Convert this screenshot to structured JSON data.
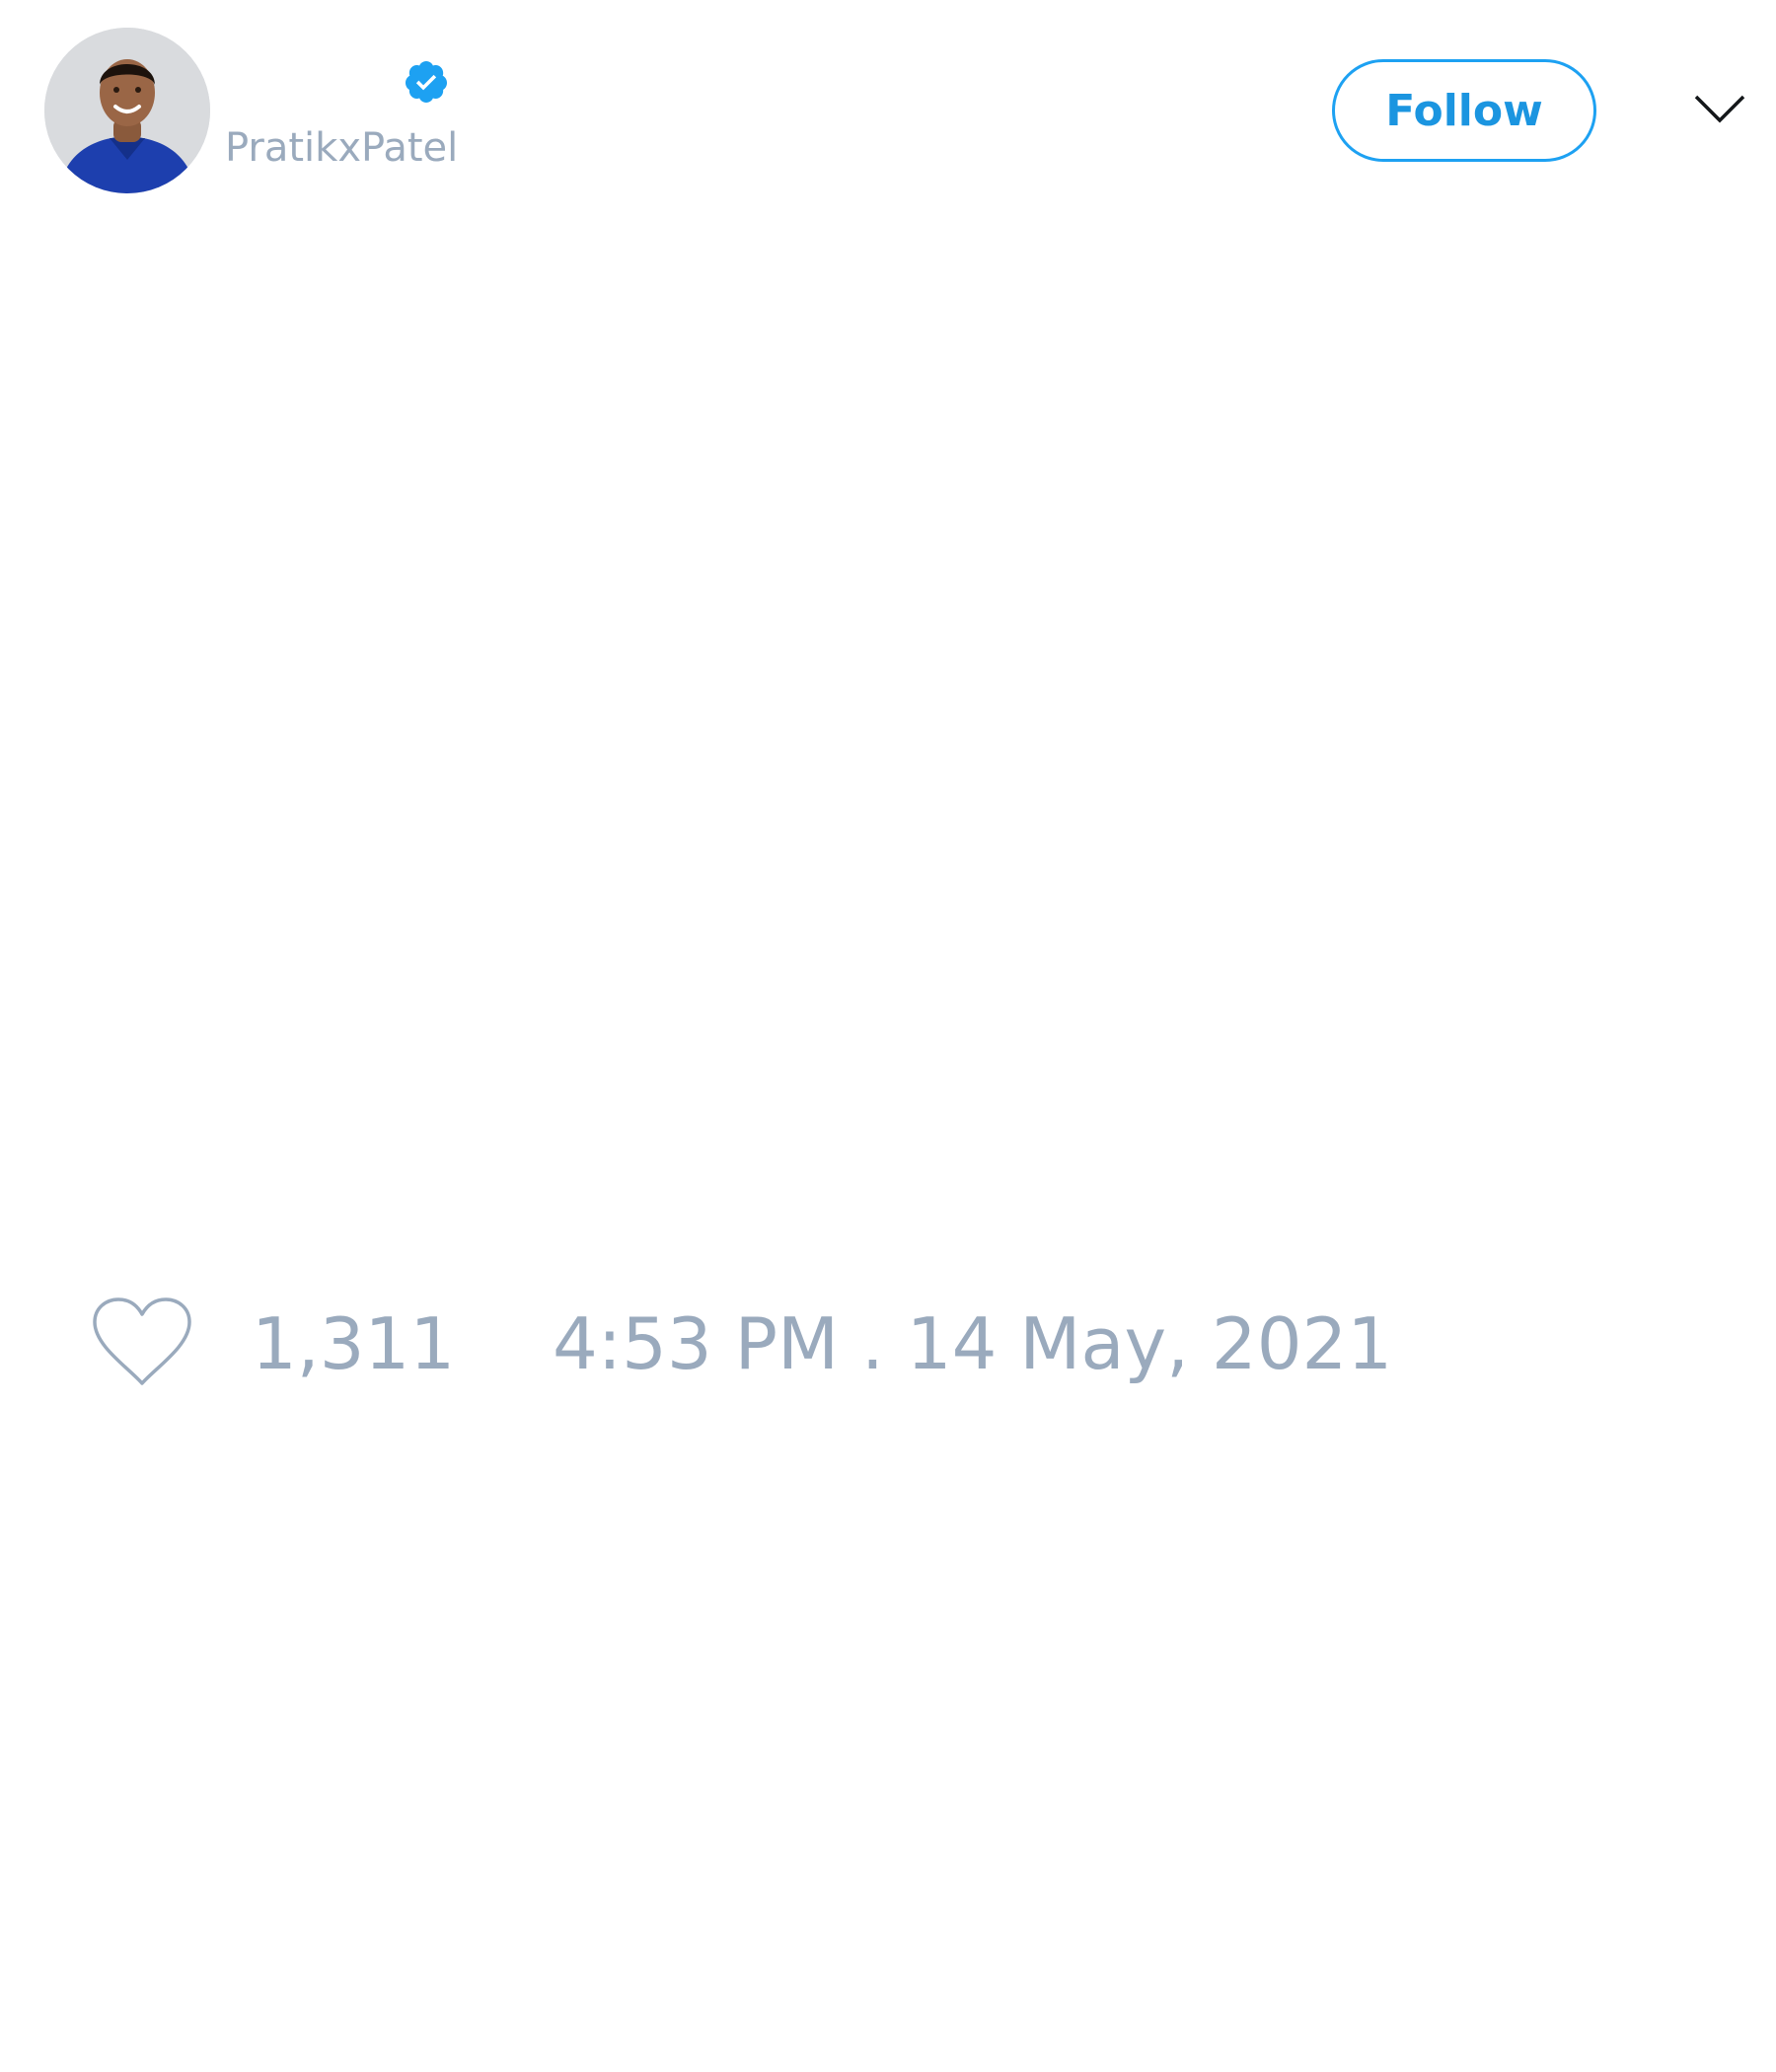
{
  "tweet": {
    "author": {
      "handle": "PratikxPatel",
      "verified": true,
      "avatar_icon": "user-avatar-photo"
    },
    "follow_button_label": "Follow",
    "menu_icon": "chevron-down-icon",
    "like_icon": "heart-outline-icon",
    "like_count": "1,311",
    "timestamp": "4:53 PM . 14 May, 2021"
  },
  "colors": {
    "accent": "#1da1f2",
    "muted_text": "#9aaabd",
    "background": "#ffffff"
  }
}
